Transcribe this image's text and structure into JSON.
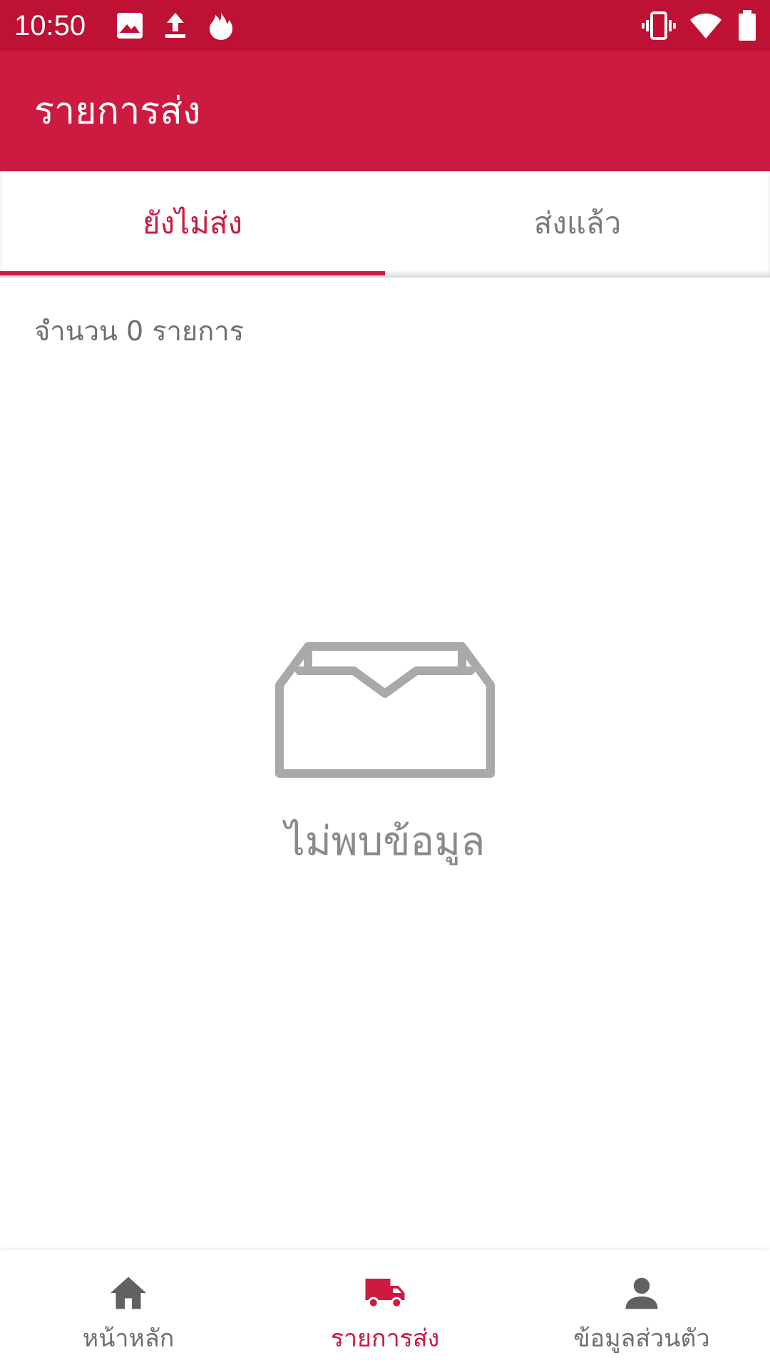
{
  "status_bar": {
    "time": "10:50",
    "icons": [
      "image-icon",
      "upload-icon",
      "flame-icon",
      "vibrate-icon",
      "wifi-icon",
      "battery-icon"
    ]
  },
  "app_bar": {
    "title": "รายการส่ง"
  },
  "tabs": [
    {
      "label": "ยังไม่ส่ง",
      "active": true
    },
    {
      "label": "ส่งแล้ว",
      "active": false
    }
  ],
  "list": {
    "count_text": "จำนวน 0 รายการ",
    "count": 0
  },
  "empty_state": {
    "icon": "empty-inbox-icon",
    "message": "ไม่พบข้อมูล"
  },
  "bottom_nav": {
    "items": [
      {
        "label": "หน้าหลัก",
        "icon": "home-icon",
        "active": false
      },
      {
        "label": "รายการส่ง",
        "icon": "truck-icon",
        "active": true
      },
      {
        "label": "ข้อมูลส่วนตัว",
        "icon": "person-icon",
        "active": false
      }
    ]
  },
  "colors": {
    "status_bar": "#be1133",
    "primary": "#cd1a41",
    "muted_text": "#6f6f6f",
    "empty_icon": "#a9a9a9",
    "nav_icon": "#616161"
  }
}
